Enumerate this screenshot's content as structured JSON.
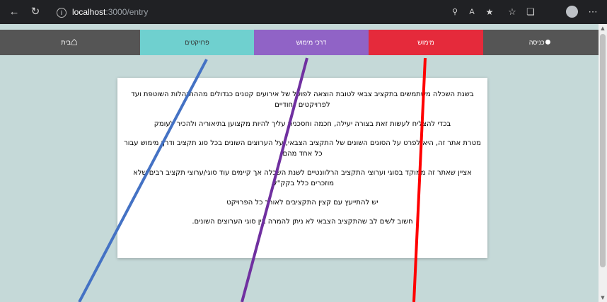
{
  "browser": {
    "back_icon": "back-arrow-icon",
    "reload_icon": "reload-icon",
    "url_host": "localhost",
    "url_path": ":3000/entry"
  },
  "nav": {
    "home": "בית",
    "projects": "פרויקטים",
    "funding_guides": "דרכי מימוש",
    "funding": "מימוש",
    "login": "כניסה"
  },
  "content": {
    "paragraphs": [
      "בשנת השכלה משתמשים בתקציב צבאי לטובת הוצאה לפועל של אירועים קטנים כגדולים מההתנהלות השוטפת ועד לפרויקטים ייחודיים",
      "בכדי להצליח לעשות זאת בצורה יעילה, חכמה וחסכנית עליך להיות מקצוען בתיאוריה ולהכיר לעומק",
      "מטרת אתר זה, היא לפרט על הסוגים השונים של התקציב הצבאי, על הערוצים השונים בכל סוג תקציב ודרך מימוש עבור כל אחד מהם",
      "אציין שאתר זה ממוקד בסוגי וערוצי התקציב הרלוונטיים לשנת השכלה אך קיימים עוד סוגי/ערוצי תקציב רבים שלא מוזכרים כלל בקק\"ל.",
      "יש להתייעץ עם קצין התקציבים לאורך כל הפרויקט",
      "חשוב לשים לב שהתקציב הצבאי לא ניתן להמרה בין סוגי הערוצים השונים."
    ]
  },
  "colors": {
    "nav_dark": "#555555",
    "projects": "#6fd0cf",
    "guides": "#9063c6",
    "funding": "#e52a3b",
    "page_bg": "#c5d9d8",
    "line_blue": "#4472c4",
    "line_purple": "#7030a0",
    "line_red": "#ff0000"
  }
}
